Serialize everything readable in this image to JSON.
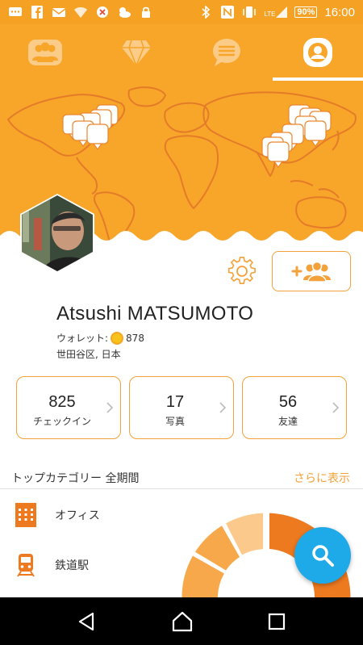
{
  "status_bar": {
    "time": "16:00",
    "battery": "90%",
    "network": "LTE"
  },
  "tabs": [
    {
      "name": "friends-tab",
      "icon": "people-icon"
    },
    {
      "name": "gems-tab",
      "icon": "diamond-icon"
    },
    {
      "name": "messages-tab",
      "icon": "chat-icon"
    },
    {
      "name": "profile-tab",
      "icon": "profile-icon",
      "active": true
    }
  ],
  "profile": {
    "name": "Atsushi MATSUMOTO",
    "wallet_label": "ウォレット:",
    "wallet_value": "878",
    "location": "世田谷区, 日本"
  },
  "stats": [
    {
      "value": "825",
      "label": "チェックイン"
    },
    {
      "value": "17",
      "label": "写真"
    },
    {
      "value": "56",
      "label": "友達"
    }
  ],
  "categories": {
    "header": "トップカテゴリー 全期間",
    "more": "さらに表示",
    "items": [
      {
        "label": "オフィス",
        "icon": "office-building-icon"
      },
      {
        "label": "鉄道駅",
        "icon": "train-icon"
      }
    ]
  },
  "colors": {
    "brand_orange": "#f8a629",
    "accent_orange": "#f3a13a",
    "fab_blue": "#1ea9e8",
    "donut_dark": "#ee7a1f",
    "donut_mid": "#f6a84a",
    "donut_light": "#fcc98c"
  }
}
